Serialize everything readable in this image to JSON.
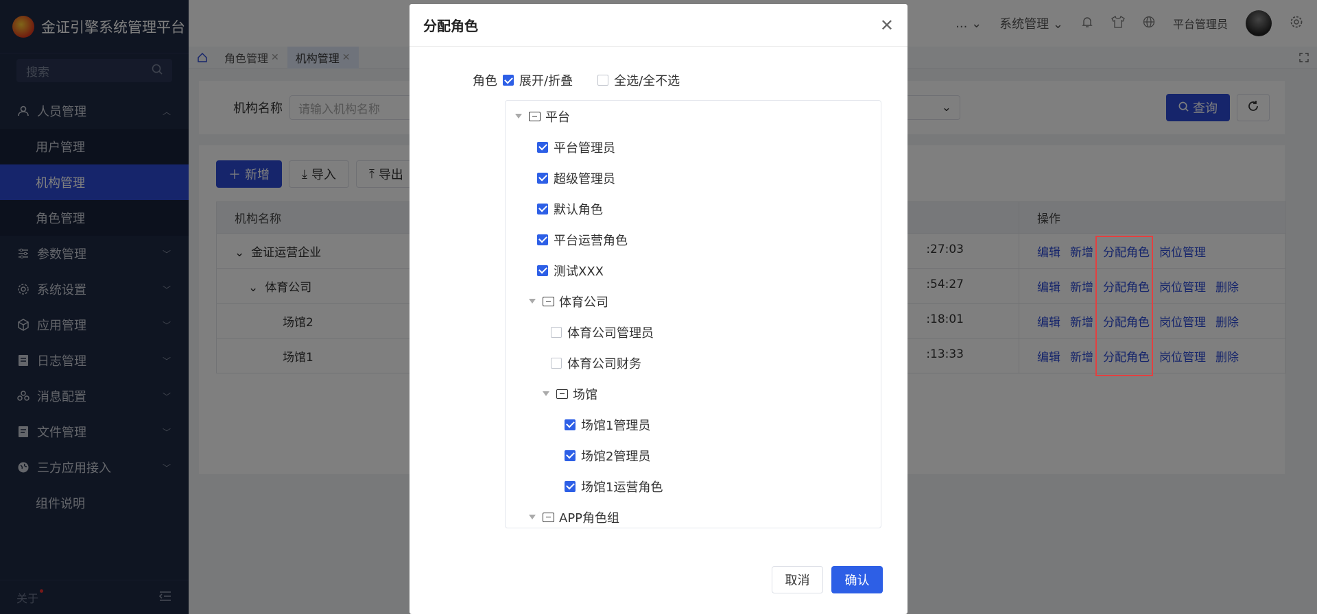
{
  "brand": {
    "title": "金证引擎系统管理平台"
  },
  "sidebar": {
    "search_placeholder": "搜索",
    "items": [
      {
        "label": "人员管理",
        "icon": "user-icon"
      },
      {
        "label": "参数管理",
        "icon": "sliders-icon"
      },
      {
        "label": "系统设置",
        "icon": "gear-icon"
      },
      {
        "label": "应用管理",
        "icon": "cube-icon"
      },
      {
        "label": "日志管理",
        "icon": "document-icon"
      },
      {
        "label": "消息配置",
        "icon": "users-icon"
      },
      {
        "label": "文件管理",
        "icon": "file-icon"
      },
      {
        "label": "三方应用接入",
        "icon": "globe-icon"
      }
    ],
    "subitems": [
      {
        "label": "用户管理"
      },
      {
        "label": "机构管理"
      },
      {
        "label": "角色管理"
      }
    ],
    "extra": "组件说明",
    "footer": "关于"
  },
  "header": {
    "ellipsis": "...",
    "menu": "系统管理",
    "user": "平台管理员"
  },
  "tabs": [
    {
      "label": "角色管理"
    },
    {
      "label": "机构管理"
    }
  ],
  "filter": {
    "label": "机构名称",
    "placeholder": "请输入机构名称",
    "query": "查询"
  },
  "toolbar": {
    "add": "新增",
    "import": "导入",
    "export": "导出"
  },
  "table": {
    "headers": [
      "机构名称",
      "操作"
    ],
    "rows": [
      {
        "name": "金证运营企业",
        "time": ":27:03"
      },
      {
        "name": "体育公司",
        "time": ":54:27"
      },
      {
        "name": "场馆2",
        "time": ":18:01"
      },
      {
        "name": "场馆1",
        "time": ":13:33"
      }
    ],
    "ops": {
      "edit": "编辑",
      "add": "新增",
      "assign": "分配角色",
      "post": "岗位管理",
      "delete": "删除"
    }
  },
  "modal": {
    "title": "分配角色",
    "role_label": "角色",
    "expand": "展开/折叠",
    "select_all": "全选/全不选",
    "tree": [
      {
        "label": "平台",
        "type": "folder"
      },
      {
        "label": "平台管理员",
        "checked": true
      },
      {
        "label": "超级管理员",
        "checked": true
      },
      {
        "label": "默认角色",
        "checked": true
      },
      {
        "label": "平台运营角色",
        "checked": true
      },
      {
        "label": "测试XXX",
        "checked": true
      },
      {
        "label": "体育公司",
        "type": "folder"
      },
      {
        "label": "体育公司管理员",
        "checked": false
      },
      {
        "label": "体育公司财务",
        "checked": false
      },
      {
        "label": "场馆",
        "type": "folder"
      },
      {
        "label": "场馆1管理员",
        "checked": true
      },
      {
        "label": "场馆2管理员",
        "checked": true
      },
      {
        "label": "场馆1运营角色",
        "checked": true
      },
      {
        "label": "APP角色组",
        "type": "folder"
      }
    ],
    "cancel": "取消",
    "confirm": "确认"
  }
}
